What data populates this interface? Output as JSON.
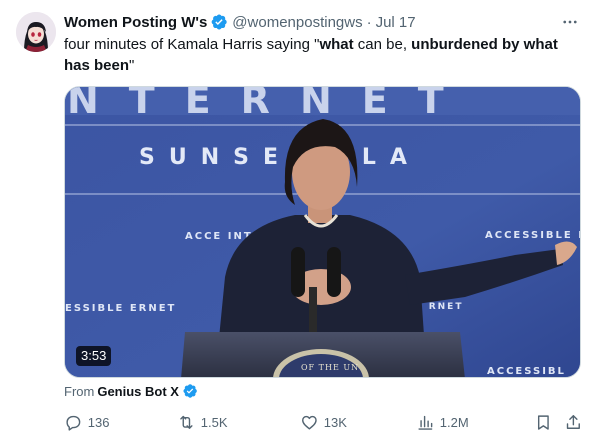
{
  "tweet": {
    "author_name": "Women Posting W's",
    "handle": "@womenpostingws",
    "separator": "·",
    "date": "Jul 17",
    "text_parts": [
      "four minutes of Kamala Harris saying \"",
      "what",
      " can be, ",
      "unburdened by what has been",
      "\""
    ],
    "video": {
      "duration": "3:53",
      "backdrop_text": {
        "top_banner": "NTERNET",
        "location": "SUNSET, LA",
        "left_sign": "ACCE INT",
        "right_sign": "ACCESSIBLE INTERNET",
        "lower_left": "ESSIBLE ERNET",
        "lower_mid": "SIBLE RNET",
        "lower_right": "ACCESSIBL",
        "seal": "OF THE UN"
      }
    },
    "source_label": "From",
    "source_name": "Genius Bot X",
    "stats": {
      "replies": "136",
      "reposts": "1.5K",
      "likes": "13K",
      "views": "1.2M"
    }
  },
  "colors": {
    "text_primary": "#0f1419",
    "text_secondary": "#536471",
    "verified": "#1d9bf0",
    "video_bg": "#3f59a6"
  },
  "icons": {
    "verified": "verified-badge-icon",
    "more": "more-horizontal-icon",
    "reply": "reply-icon",
    "repost": "repost-icon",
    "like": "heart-icon",
    "views": "views-chart-icon",
    "bookmark": "bookmark-icon",
    "share": "share-icon"
  }
}
